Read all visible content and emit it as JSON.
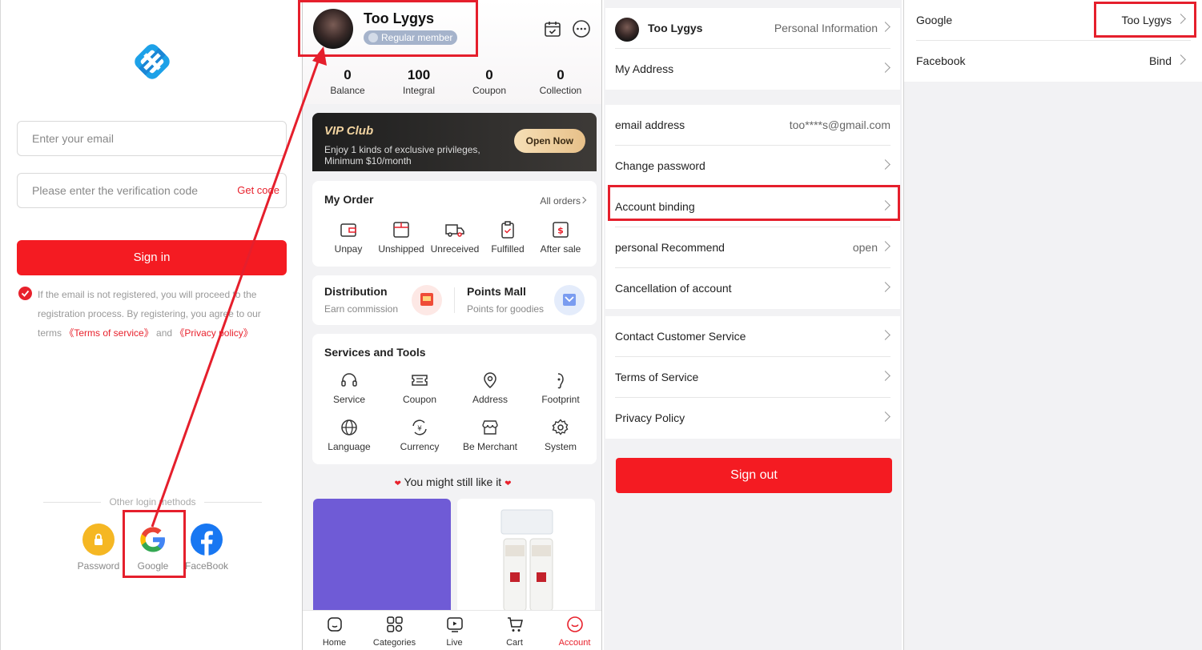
{
  "login": {
    "email_placeholder": "Enter your email",
    "code_placeholder": "Please enter the verification code",
    "get_code": "Get code",
    "sign_in": "Sign in",
    "agree_text_1": "If the email is not registered, you will proceed to the registration process. By registering, you agree to our terms",
    "terms_link": "《Terms of service》",
    "and": "and",
    "privacy_link": "《Privacy policy》",
    "other_methods": "Other login methods",
    "methods": [
      {
        "label": "Password",
        "icon": "lock-icon",
        "color": "#f5b723"
      },
      {
        "label": "Google",
        "icon": "google-icon"
      },
      {
        "label": "FaceBook",
        "icon": "facebook-icon",
        "color": "#1877f2"
      }
    ]
  },
  "account": {
    "username": "Too Lygys",
    "member_level": "Regular member",
    "stats": [
      {
        "value": "0",
        "label": "Balance"
      },
      {
        "value": "100",
        "label": "Integral"
      },
      {
        "value": "0",
        "label": "Coupon"
      },
      {
        "value": "0",
        "label": "Collection"
      }
    ],
    "vip": {
      "title": "VIP Club",
      "desc_1": "Enjoy 1 kinds of exclusive privileges,",
      "desc_2": "Minimum $10/month",
      "button": "Open Now"
    },
    "order": {
      "title": "My Order",
      "all": "All orders",
      "items": [
        "Unpay",
        "Unshipped",
        "Unreceived",
        "Fulfilled",
        "After sale"
      ]
    },
    "distribution": {
      "title": "Distribution",
      "sub": "Earn commission"
    },
    "points_mall": {
      "title": "Points Mall",
      "sub": "Points for goodies"
    },
    "services": {
      "title": "Services and Tools",
      "items": [
        "Service",
        "Coupon",
        "Address",
        "Footprint",
        "Language",
        "Currency",
        "Be Merchant",
        "System"
      ]
    },
    "recommend_title": "You might still like it",
    "tabs": [
      "Home",
      "Categories",
      "Live",
      "Cart",
      "Account"
    ],
    "accent": "#f41b22"
  },
  "settings": {
    "username": "Too Lygys",
    "personal_info": "Personal Information",
    "my_address": "My Address",
    "email_label": "email address",
    "email_value": "too****s@gmail.com",
    "change_password": "Change password",
    "account_binding": "Account binding",
    "personal_recommend": "personal Recommend",
    "personal_recommend_value": "open",
    "cancellation": "Cancellation of account",
    "contact": "Contact Customer Service",
    "terms": "Terms of Service",
    "privacy": "Privacy Policy",
    "sign_out": "Sign out"
  },
  "binding": {
    "google_label": "Google",
    "google_value": "Too Lygys",
    "facebook_label": "Facebook",
    "facebook_value": "Bind"
  }
}
